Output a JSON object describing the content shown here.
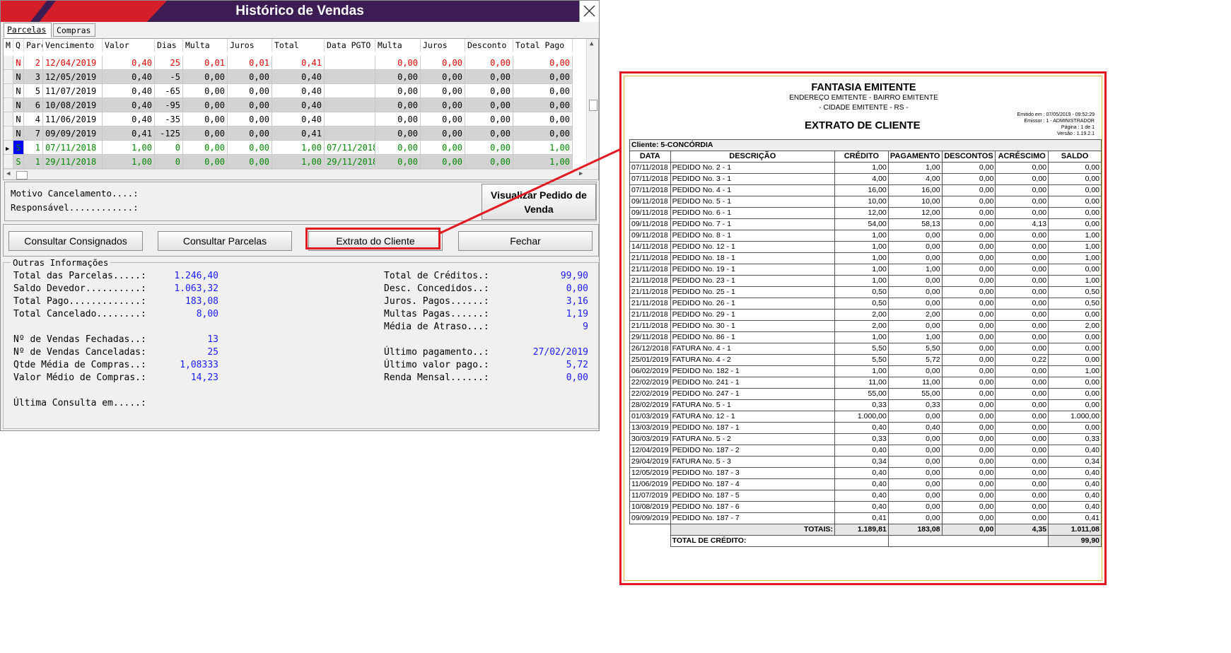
{
  "window": {
    "title": "Histórico de Vendas",
    "colors": {
      "brand_red": "#d41f2b",
      "brand_purple": "#3d1c54",
      "highlight_red": "#e21b23"
    }
  },
  "tabs": [
    {
      "label": "Parcelas",
      "active": true
    },
    {
      "label": "Compras",
      "active": false
    }
  ],
  "grid": {
    "columns": [
      "M",
      "Q",
      "Parc",
      "Vencimento",
      "Valor",
      "Dias",
      "Multa",
      "Juros",
      "Total",
      "Data PGTO",
      "Multa",
      "Juros",
      "Desconto",
      "Total Pago"
    ],
    "rows": [
      {
        "q": "N",
        "parc": "2",
        "venc": "12/04/2019",
        "valor": "0,40",
        "dias": "25",
        "multa": "0,01",
        "juros": "0,01",
        "total": "0,41",
        "dpgto": "",
        "multa2": "0,00",
        "juros2": "0,00",
        "desc": "0,00",
        "tpago": "0,00",
        "color": "#e00000",
        "shade": false,
        "current": false
      },
      {
        "q": "N",
        "parc": "3",
        "venc": "12/05/2019",
        "valor": "0,40",
        "dias": "-5",
        "multa": "0,00",
        "juros": "0,00",
        "total": "0,40",
        "dpgto": "",
        "multa2": "0,00",
        "juros2": "0,00",
        "desc": "0,00",
        "tpago": "0,00",
        "color": "#000000",
        "shade": true,
        "current": false
      },
      {
        "q": "N",
        "parc": "5",
        "venc": "11/07/2019",
        "valor": "0,40",
        "dias": "-65",
        "multa": "0,00",
        "juros": "0,00",
        "total": "0,40",
        "dpgto": "",
        "multa2": "0,00",
        "juros2": "0,00",
        "desc": "0,00",
        "tpago": "0,00",
        "color": "#000000",
        "shade": false,
        "current": false
      },
      {
        "q": "N",
        "parc": "6",
        "venc": "10/08/2019",
        "valor": "0,40",
        "dias": "-95",
        "multa": "0,00",
        "juros": "0,00",
        "total": "0,40",
        "dpgto": "",
        "multa2": "0,00",
        "juros2": "0,00",
        "desc": "0,00",
        "tpago": "0,00",
        "color": "#000000",
        "shade": true,
        "current": false
      },
      {
        "q": "N",
        "parc": "4",
        "venc": "11/06/2019",
        "valor": "0,40",
        "dias": "-35",
        "multa": "0,00",
        "juros": "0,00",
        "total": "0,40",
        "dpgto": "",
        "multa2": "0,00",
        "juros2": "0,00",
        "desc": "0,00",
        "tpago": "0,00",
        "color": "#000000",
        "shade": false,
        "current": false
      },
      {
        "q": "N",
        "parc": "7",
        "venc": "09/09/2019",
        "valor": "0,41",
        "dias": "-125",
        "multa": "0,00",
        "juros": "0,00",
        "total": "0,41",
        "dpgto": "",
        "multa2": "0,00",
        "juros2": "0,00",
        "desc": "0,00",
        "tpago": "0,00",
        "color": "#000000",
        "shade": true,
        "current": false
      },
      {
        "q": "S",
        "parc": "1",
        "venc": "07/11/2018",
        "valor": "1,00",
        "dias": "0",
        "multa": "0,00",
        "juros": "0,00",
        "total": "1,00",
        "dpgto": "07/11/2018",
        "multa2": "0,00",
        "juros2": "0,00",
        "desc": "0,00",
        "tpago": "1,00",
        "color": "#008800",
        "shade": false,
        "current": true
      },
      {
        "q": "S",
        "parc": "1",
        "venc": "29/11/2018",
        "valor": "1,00",
        "dias": "0",
        "multa": "0,00",
        "juros": "0,00",
        "total": "1,00",
        "dpgto": "29/11/2018",
        "multa2": "0,00",
        "juros2": "0,00",
        "desc": "0,00",
        "tpago": "1,00",
        "color": "#008800",
        "shade": true,
        "current": false
      }
    ]
  },
  "cancel_panel": {
    "motivo_label": "Motivo Cancelamento....:",
    "responsavel_label": "Responsável............:",
    "visualizar_line1": "Visualizar Pedido de",
    "visualizar_line2": "Venda"
  },
  "buttons": {
    "consignados": "Consultar Consignados",
    "parcelas": "Consultar Parcelas",
    "extrato": "Extrato do Cliente",
    "fechar": "Fechar"
  },
  "outras_info": {
    "legend": "Outras Informações",
    "left": [
      {
        "label": "Total das Parcelas.....:",
        "value": "1.246,40"
      },
      {
        "label": "Saldo Devedor..........:",
        "value": "1.063,32"
      },
      {
        "label": "Total Pago.............:",
        "value": "183,08"
      },
      {
        "label": "Total Cancelado........:",
        "value": "8,00"
      },
      {
        "label": "",
        "value": ""
      },
      {
        "label": "Nº de Vendas Fechadas..:",
        "value": "13"
      },
      {
        "label": "Nº de Vendas Canceladas:",
        "value": "25"
      },
      {
        "label": "Qtde Média de Compras..:",
        "value": "1,08333"
      },
      {
        "label": "Valor Médio de Compras.:",
        "value": "14,23"
      },
      {
        "label": "",
        "value": ""
      },
      {
        "label": "Última Consulta em.....:",
        "value": ""
      }
    ],
    "right": [
      {
        "label": "Total de Créditos.:",
        "value": "99,90"
      },
      {
        "label": "Desc. Concedidos..:",
        "value": "0,00"
      },
      {
        "label": "Juros. Pagos......:",
        "value": "3,16"
      },
      {
        "label": "Multas Pagas......:",
        "value": "1,19"
      },
      {
        "label": "Média de Atraso...:",
        "value": "9"
      },
      {
        "label": "Último pagamento..:",
        "value": "27/02/2019"
      },
      {
        "label": "Último valor pago.:",
        "value": "5,72"
      },
      {
        "label": "Renda Mensal......:",
        "value": "0,00"
      }
    ]
  },
  "report": {
    "company": "FANTASIA EMITENTE",
    "address": "ENDEREÇO EMITENTE - BAIRRO EMITENTE",
    "city": "- CIDADE EMITENTE - RS -",
    "meta": [
      "Emitido em : 07/05/2019 - 09:52:29",
      "Emissor : 1 - ADMINISTRADOR",
      "Página : 1 de 1",
      "Versão : 1.19.2.1"
    ],
    "title": "EXTRATO DE CLIENTE",
    "client": "Cliente: 5-CONCÓRDIA",
    "headers": [
      "DATA",
      "DESCRIÇÃO",
      "CRÉDITO",
      "PAGAMENTO",
      "DESCONTOS",
      "ACRÉSCIMO",
      "SALDO"
    ],
    "rows": [
      [
        "07/11/2018",
        "PEDIDO No. 2 - 1",
        "1,00",
        "1,00",
        "0,00",
        "0,00",
        "0,00"
      ],
      [
        "07/11/2018",
        "PEDIDO No. 3 - 1",
        "4,00",
        "4,00",
        "0,00",
        "0,00",
        "0,00"
      ],
      [
        "07/11/2018",
        "PEDIDO No. 4 - 1",
        "16,00",
        "16,00",
        "0,00",
        "0,00",
        "0,00"
      ],
      [
        "09/11/2018",
        "PEDIDO No. 5 - 1",
        "10,00",
        "10,00",
        "0,00",
        "0,00",
        "0,00"
      ],
      [
        "09/11/2018",
        "PEDIDO No. 6 - 1",
        "12,00",
        "12,00",
        "0,00",
        "0,00",
        "0,00"
      ],
      [
        "09/11/2018",
        "PEDIDO No. 7 - 1",
        "54,00",
        "58,13",
        "0,00",
        "4,13",
        "0,00"
      ],
      [
        "09/11/2018",
        "PEDIDO No. 8 - 1",
        "1,00",
        "0,00",
        "0,00",
        "0,00",
        "1,00"
      ],
      [
        "14/11/2018",
        "PEDIDO No. 12 - 1",
        "1,00",
        "0,00",
        "0,00",
        "0,00",
        "1,00"
      ],
      [
        "21/11/2018",
        "PEDIDO No. 18 - 1",
        "1,00",
        "0,00",
        "0,00",
        "0,00",
        "1,00"
      ],
      [
        "21/11/2018",
        "PEDIDO No. 19 - 1",
        "1,00",
        "1,00",
        "0,00",
        "0,00",
        "0,00"
      ],
      [
        "21/11/2018",
        "PEDIDO No. 23 - 1",
        "1,00",
        "0,00",
        "0,00",
        "0,00",
        "1,00"
      ],
      [
        "21/11/2018",
        "PEDIDO No. 25 - 1",
        "0,50",
        "0,00",
        "0,00",
        "0,00",
        "0,50"
      ],
      [
        "21/11/2018",
        "PEDIDO No. 26 - 1",
        "0,50",
        "0,00",
        "0,00",
        "0,00",
        "0,50"
      ],
      [
        "21/11/2018",
        "PEDIDO No. 29 - 1",
        "2,00",
        "2,00",
        "0,00",
        "0,00",
        "0,00"
      ],
      [
        "21/11/2018",
        "PEDIDO No. 30 - 1",
        "2,00",
        "0,00",
        "0,00",
        "0,00",
        "2,00"
      ],
      [
        "29/11/2018",
        "PEDIDO No. 86 - 1",
        "1,00",
        "1,00",
        "0,00",
        "0,00",
        "0,00"
      ],
      [
        "26/12/2018",
        "FATURA No. 4 - 1",
        "5,50",
        "5,50",
        "0,00",
        "0,00",
        "0,00"
      ],
      [
        "25/01/2019",
        "FATURA No. 4 - 2",
        "5,50",
        "5,72",
        "0,00",
        "0,22",
        "0,00"
      ],
      [
        "06/02/2019",
        "PEDIDO No. 182 - 1",
        "1,00",
        "0,00",
        "0,00",
        "0,00",
        "1,00"
      ],
      [
        "22/02/2019",
        "PEDIDO No. 241 - 1",
        "11,00",
        "11,00",
        "0,00",
        "0,00",
        "0,00"
      ],
      [
        "22/02/2019",
        "PEDIDO No. 247 - 1",
        "55,00",
        "55,00",
        "0,00",
        "0,00",
        "0,00"
      ],
      [
        "28/02/2019",
        "FATURA No. 5 - 1",
        "0,33",
        "0,33",
        "0,00",
        "0,00",
        "0,00"
      ],
      [
        "01/03/2019",
        "FATURA No. 12 - 1",
        "1.000,00",
        "0,00",
        "0,00",
        "0,00",
        "1.000,00"
      ],
      [
        "13/03/2019",
        "PEDIDO No. 187 - 1",
        "0,40",
        "0,40",
        "0,00",
        "0,00",
        "0,00"
      ],
      [
        "30/03/2019",
        "FATURA No. 5 - 2",
        "0,33",
        "0,00",
        "0,00",
        "0,00",
        "0,33"
      ],
      [
        "12/04/2019",
        "PEDIDO No. 187 - 2",
        "0,40",
        "0,00",
        "0,00",
        "0,00",
        "0,40"
      ],
      [
        "29/04/2019",
        "FATURA No. 5 - 3",
        "0,34",
        "0,00",
        "0,00",
        "0,00",
        "0,34"
      ],
      [
        "12/05/2019",
        "PEDIDO No. 187 - 3",
        "0,40",
        "0,00",
        "0,00",
        "0,00",
        "0,40"
      ],
      [
        "11/06/2019",
        "PEDIDO No. 187 - 4",
        "0,40",
        "0,00",
        "0,00",
        "0,00",
        "0,40"
      ],
      [
        "11/07/2019",
        "PEDIDO No. 187 - 5",
        "0,40",
        "0,00",
        "0,00",
        "0,00",
        "0,40"
      ],
      [
        "10/08/2019",
        "PEDIDO No. 187 - 6",
        "0,40",
        "0,00",
        "0,00",
        "0,00",
        "0,40"
      ],
      [
        "09/09/2019",
        "PEDIDO No. 187 - 7",
        "0,41",
        "0,00",
        "0,00",
        "0,00",
        "0,41"
      ]
    ],
    "totals": {
      "label": "TOTAIS:",
      "credito": "1.189,81",
      "pagamento": "183,08",
      "descontos": "0,00",
      "acrescimo": "4,35",
      "saldo": "1.011,08"
    },
    "total_credito": {
      "label": "TOTAL DE CRÉDITO:",
      "value": "99,90"
    }
  }
}
